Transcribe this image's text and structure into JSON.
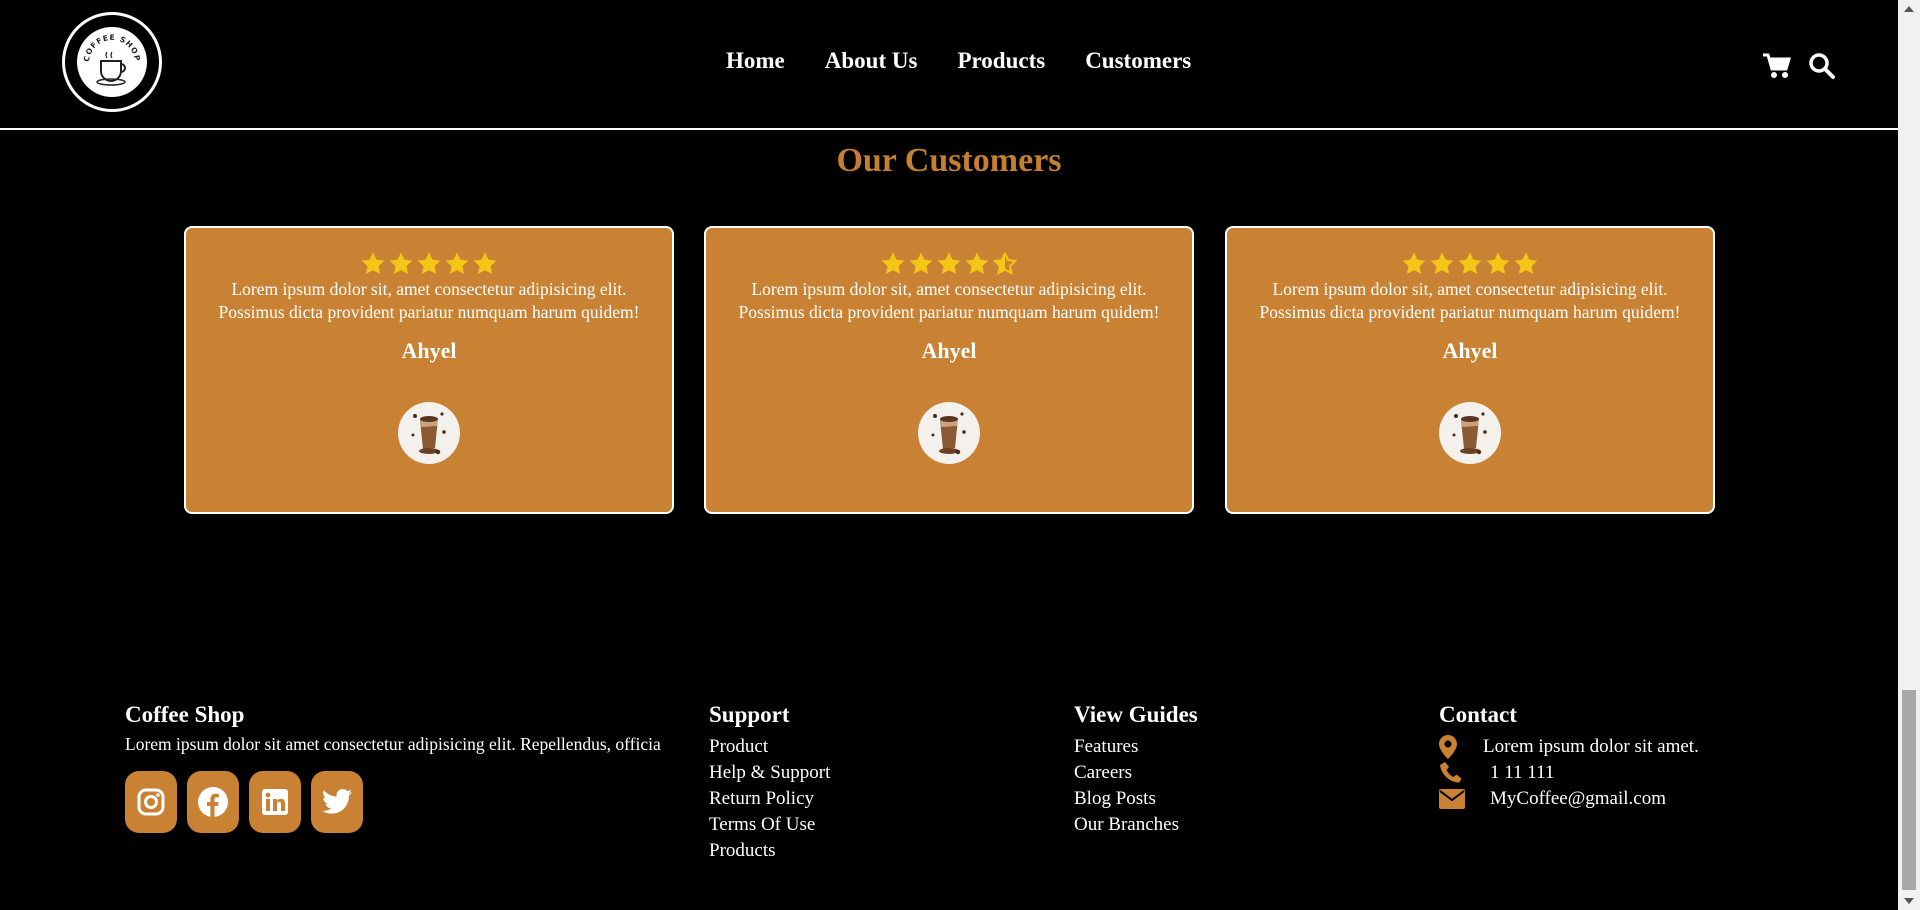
{
  "header": {
    "logo_text": "COFFEE SHOP",
    "nav": [
      "Home",
      "About Us",
      "Products",
      "Customers"
    ],
    "icons": [
      "cart-icon",
      "search-icon"
    ]
  },
  "customers": {
    "title": "Our Customers",
    "cards": [
      {
        "rating": 5,
        "quote_line1": "Lorem ipsum dolor sit, amet consectetur adipisicing elit.",
        "quote_line2": "Possimus dicta provident pariatur numquam harum quidem!",
        "name": "Ahyel"
      },
      {
        "rating": 4.5,
        "quote_line1": "Lorem ipsum dolor sit, amet consectetur adipisicing elit.",
        "quote_line2": "Possimus dicta provident pariatur numquam harum quidem!",
        "name": "Ahyel"
      },
      {
        "rating": 5,
        "quote_line1": "Lorem ipsum dolor sit, amet consectetur adipisicing elit.",
        "quote_line2": "Possimus dicta provident pariatur numquam harum quidem!",
        "name": "Ahyel"
      }
    ]
  },
  "footer": {
    "brand": {
      "title": "Coffee Shop",
      "text": "Lorem ipsum dolor sit amet consectetur adipisicing elit. Repellendus, officia",
      "socials": [
        "instagram-icon",
        "facebook-icon",
        "linkedin-icon",
        "twitter-icon"
      ]
    },
    "support": {
      "title": "Support",
      "links": [
        "Product",
        "Help & Support",
        "Return Policy",
        "Terms Of Use",
        "Products"
      ]
    },
    "guides": {
      "title": "View Guides",
      "links": [
        "Features",
        "Careers",
        "Blog Posts",
        "Our Branches"
      ]
    },
    "contact": {
      "title": "Contact",
      "address": "Lorem ipsum dolor sit amet.",
      "phone": "1 11 111",
      "email": "MyCoffee@gmail.com"
    }
  },
  "colors": {
    "accent": "#c98233",
    "title": "#c47f2f",
    "star": "#f5c518",
    "background": "#000000"
  }
}
